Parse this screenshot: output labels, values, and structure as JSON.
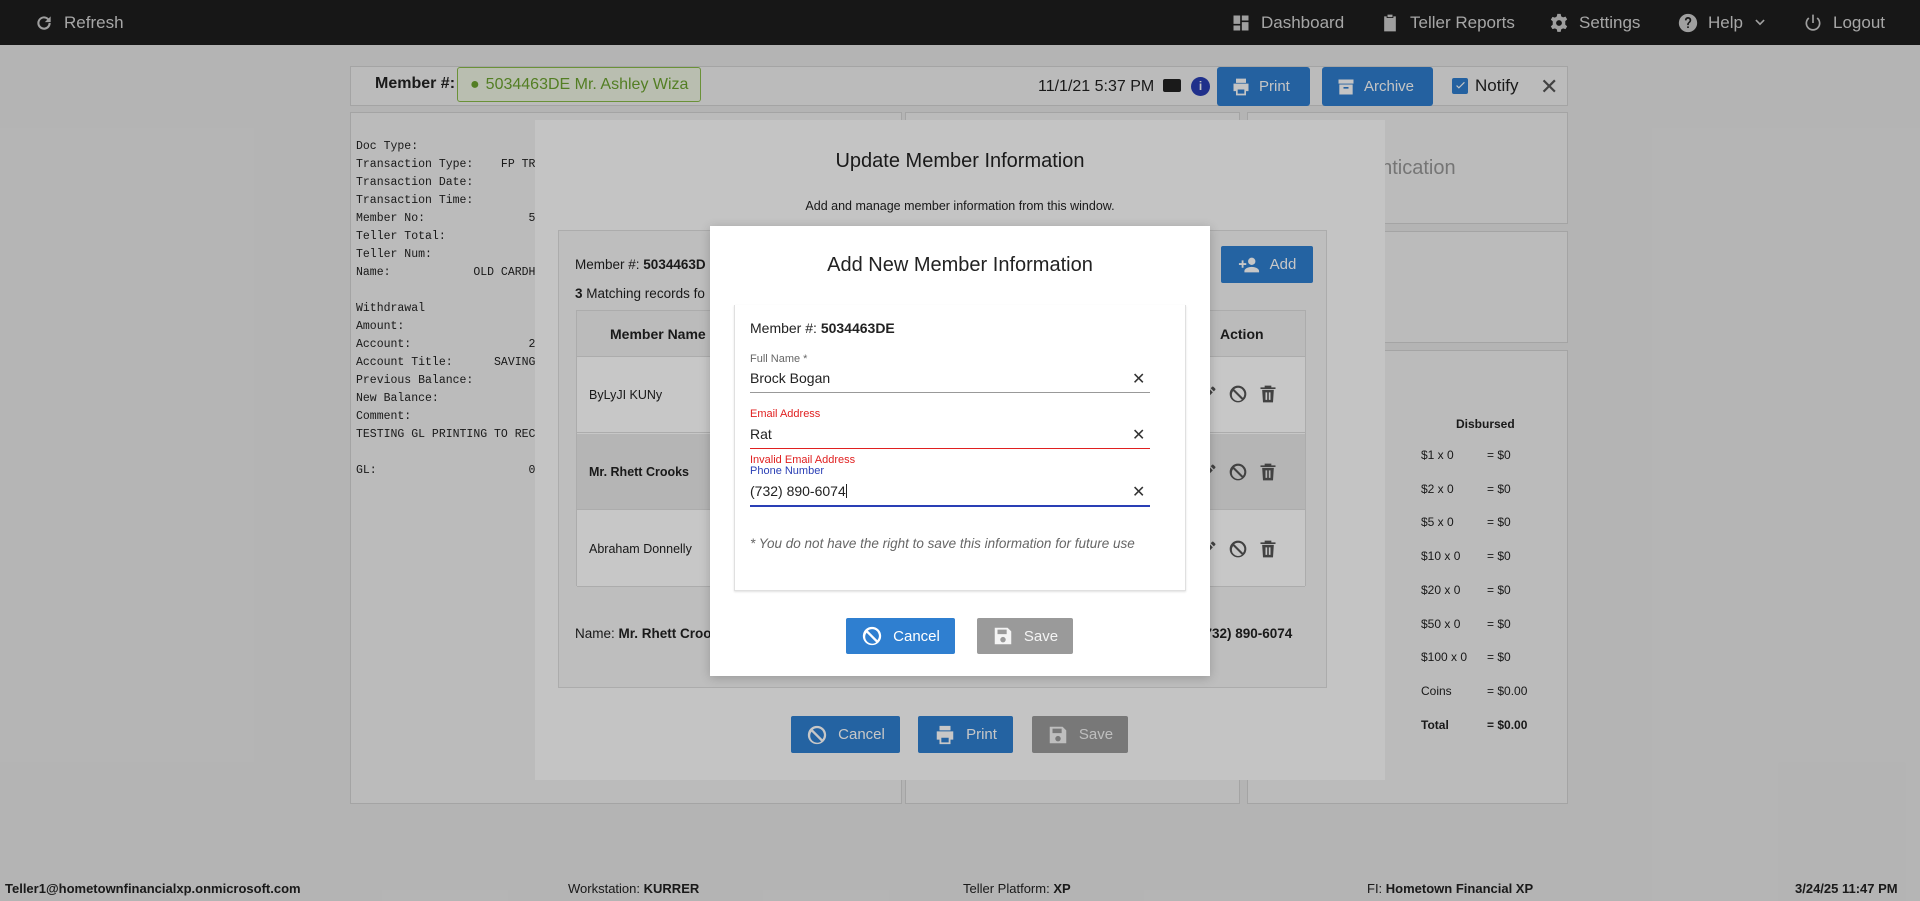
{
  "topbar": {
    "refresh": "Refresh",
    "dashboard": "Dashboard",
    "teller_reports": "Teller Reports",
    "settings": "Settings",
    "help": "Help",
    "logout": "Logout"
  },
  "memberbar": {
    "label": "Member #:",
    "member_value": "5034463DE Mr. Ashley Wiza",
    "datetime": "11/1/21 5:37 PM",
    "print": "Print",
    "archive": "Archive",
    "notify": "Notify"
  },
  "receipt": [
    "Doc Type:",
    "Transaction Type:    FP TRA",
    "Transaction Date:",
    "Transaction Time:",
    "Member No:               5",
    "Teller Total:",
    "Teller Num:",
    "Name:            OLD CARDH",
    "",
    "Withdrawal",
    "Amount:",
    "Account:                 2",
    "Account Title:      SAVINGS",
    "Previous Balance:",
    "New Balance:",
    "Comment:",
    "TESTING GL PRINTING TO RECE",
    "",
    "GL:                      0"
  ],
  "auth_title": "entication",
  "cash": {
    "header": "Disbursed",
    "rows": [
      {
        "label": "$1 x 0",
        "value": "= $0"
      },
      {
        "label": "$2 x 0",
        "value": "= $0"
      },
      {
        "label": "$5 x 0",
        "value": "= $0"
      },
      {
        "label": "$10 x 0",
        "value": "= $0"
      },
      {
        "label": "$20 x 0",
        "value": "= $0"
      },
      {
        "label": "$50 x 0",
        "value": "= $0"
      },
      {
        "label": "$100 x 0",
        "value": "= $0"
      },
      {
        "label": "Coins",
        "value": "= $0.00"
      },
      {
        "label": "Total",
        "value": "= $0.00"
      }
    ]
  },
  "update_modal": {
    "title": "Update Member Information",
    "subtitle": "Add and manage member information from this window.",
    "member_label": "Member #:",
    "member_value": "5034463D",
    "matching_count": "3",
    "matching_text": "Matching records fo",
    "add": "Add",
    "col_name": "Member Name",
    "col_action": "Action",
    "rows": [
      "ByLyJI KUNy",
      "Mr. Rhett Crooks",
      "Abraham Donnelly"
    ],
    "name_label": "Name:",
    "name_value": "Mr. Rhett Croo",
    "phone_value": "(732) 890-6074",
    "cancel": "Cancel",
    "print": "Print",
    "save": "Save"
  },
  "add_modal": {
    "title": "Add New Member Information",
    "member_label": "Member #:",
    "member_value": "5034463DE",
    "full_name_label": "Full Name *",
    "full_name_value": "Brock Bogan",
    "email_label": "Email Address",
    "email_value": "Rat",
    "email_error": "Invalid Email Address",
    "phone_label": "Phone Number",
    "phone_value": "(732) 890-6074",
    "notice": "* You do not have the right to save this information for future use",
    "cancel": "Cancel",
    "save": "Save"
  },
  "footer": {
    "user": "Teller1@hometownfinancialxp.onmicrosoft.com",
    "workstation_label": "Workstation:",
    "workstation": "KURRER",
    "platform_label": "Teller Platform:",
    "platform": "XP",
    "fi_label": "FI:",
    "fi": "Hometown Financial XP",
    "datetime": "3/24/25 11:47 PM"
  },
  "colors": {
    "accent": "#2f7fd0",
    "error": "#e02020",
    "focus": "#2a3fb5",
    "member_green": "#6da52f"
  }
}
